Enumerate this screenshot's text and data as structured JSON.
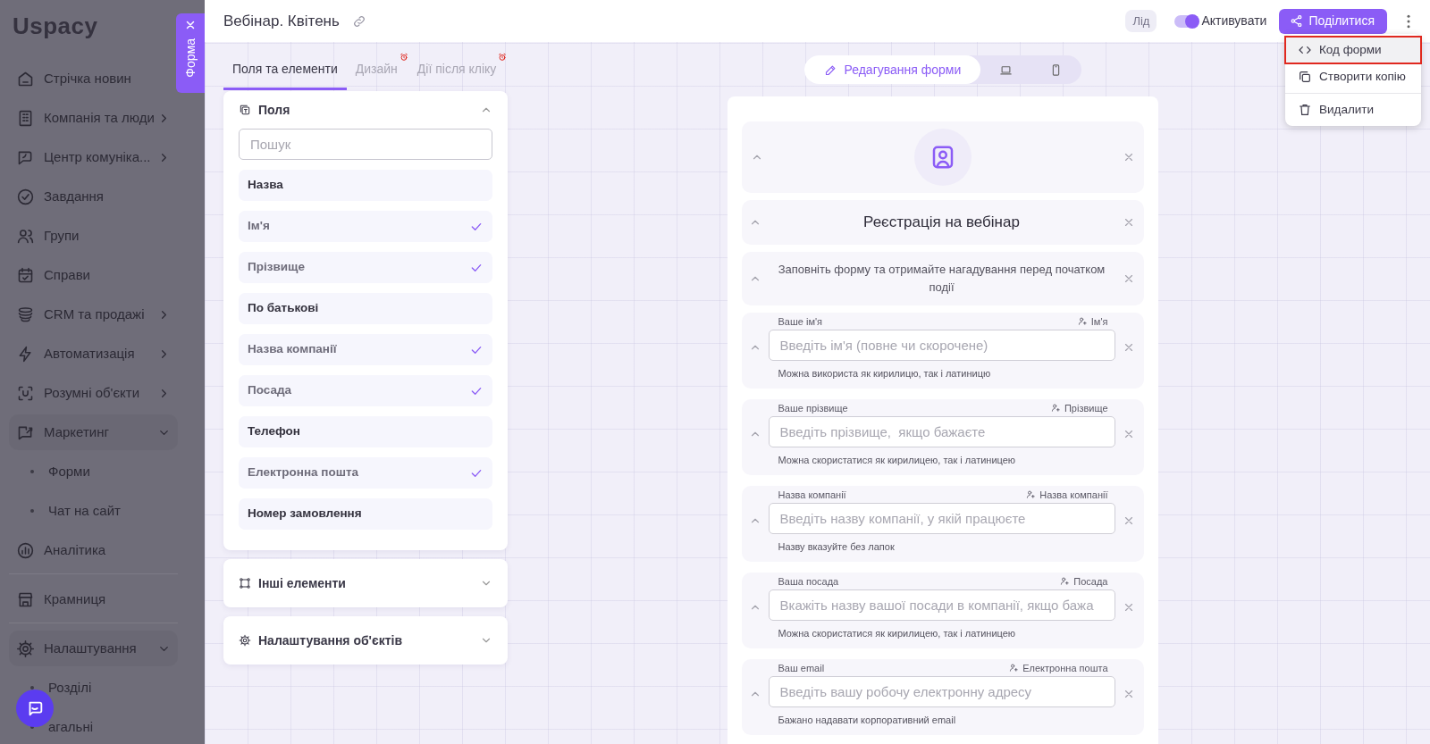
{
  "sidebar": {
    "logo": "Uspacy",
    "items": [
      {
        "label": "Стрічка новин",
        "kind": "plain"
      },
      {
        "label": "Компанія та люди",
        "kind": "submenu",
        "expanded": false
      },
      {
        "label": "Центр комуніка...",
        "kind": "submenu",
        "expanded": false
      },
      {
        "label": "Завдання",
        "kind": "plain"
      },
      {
        "label": "Групи",
        "kind": "plain"
      },
      {
        "label": "Справи",
        "kind": "plain"
      },
      {
        "label": "CRM та продажі",
        "kind": "submenu",
        "expanded": false
      },
      {
        "label": "Автоматизація",
        "kind": "submenu",
        "expanded": false
      },
      {
        "label": "Розумні об'єкти",
        "kind": "submenu",
        "expanded": false
      },
      {
        "label": "Маркетинг",
        "kind": "submenu",
        "expanded": true,
        "children": [
          {
            "label": "Форми"
          },
          {
            "label": "Чат на сайт"
          }
        ]
      },
      {
        "label": "Аналітика",
        "kind": "plain"
      },
      {
        "label": "Крамниця",
        "kind": "plain",
        "divider_before": true
      },
      {
        "label": "Налаштування",
        "kind": "submenu",
        "expanded": true,
        "divider_before": true,
        "children": [
          {
            "label": "Розділі"
          },
          {
            "label": "агальні"
          }
        ]
      }
    ]
  },
  "side_tab": {
    "label": "Форма"
  },
  "header": {
    "title": "Вебінар. Квітень",
    "badge": "Лід",
    "toggle": {
      "label": "Активувати",
      "on": true
    },
    "share_button": "Поділитися",
    "menu": [
      {
        "label": "Код форми",
        "highlighted": true
      },
      {
        "label": "Створити копію",
        "highlighted": false
      },
      {
        "label": "Видалити",
        "highlighted": false
      }
    ]
  },
  "left_tabs": [
    {
      "label": "Поля та елементи",
      "selected": true,
      "alert": false
    },
    {
      "label": "Дизайн",
      "selected": false,
      "alert": true
    },
    {
      "label": "Дії після кліку",
      "selected": false,
      "alert": true
    }
  ],
  "fields_section": {
    "title": "Поля",
    "expanded": true,
    "search": {
      "placeholder": "Пошук"
    },
    "items": [
      {
        "label": "Назва",
        "checked": false
      },
      {
        "label": "Ім'я",
        "checked": true
      },
      {
        "label": "Прізвище",
        "checked": true
      },
      {
        "label": "По батькові",
        "checked": false
      },
      {
        "label": "Назва компанії",
        "checked": true
      },
      {
        "label": "Посада",
        "checked": true
      },
      {
        "label": "Телефон",
        "checked": false
      },
      {
        "label": "Електронна пошта",
        "checked": true
      },
      {
        "label": "Номер замовлення",
        "checked": false
      }
    ]
  },
  "other_sections": [
    {
      "title": "Інші елементи",
      "expanded": false
    },
    {
      "title": "Налаштування об'єктів",
      "expanded": false
    }
  ],
  "view_switcher": [
    {
      "label": "Редагування форми",
      "selected": true
    },
    {
      "selected": false
    },
    {
      "selected": false
    }
  ],
  "form_blocks": [
    {
      "kind": "avatar"
    },
    {
      "kind": "heading",
      "text": "Реєстрація на вебінар"
    },
    {
      "kind": "text",
      "text": "Заповніть форму та отримайте нагадування перед початком події"
    },
    {
      "kind": "field",
      "label": "Ваше ім'я",
      "mapping": "Ім'я",
      "placeholder": "Введіть ім'я (повне чи скорочене)",
      "hint": "Можна використа як кирилицю, так і латиницю"
    },
    {
      "kind": "field",
      "label": "Ваше прізвище",
      "mapping": "Прізвище",
      "placeholder": "Введіть прізвище,  якщо бажаєте",
      "hint": "Можна скористатися як кирилицею, так і латиницею"
    },
    {
      "kind": "field",
      "label": "Назва компанії",
      "mapping": "Назва компанії",
      "placeholder": "Введіть назву компанії, у якій працюєте",
      "hint": "Назву вказуйте без лапок"
    },
    {
      "kind": "field",
      "label": "Ваша посада",
      "mapping": "Посада",
      "placeholder": "Вкажіть назву вашої посади в компанії, якщо бажа",
      "hint": "Можна скористатися як кирилицею, так і латиницею"
    },
    {
      "kind": "field",
      "label": "Ваш email",
      "mapping": "Електронна пошта",
      "placeholder": "Введіть вашу робочу електронну адресу",
      "hint": "Бажано надавати корпоративний email"
    }
  ]
}
